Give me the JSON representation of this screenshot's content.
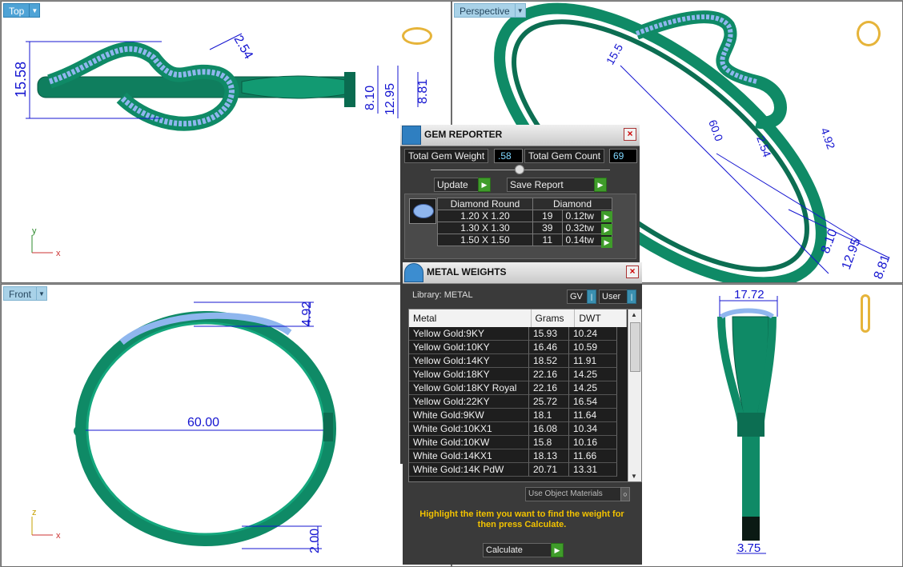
{
  "viewports": {
    "top": {
      "label": "Top",
      "axis_y": "y",
      "axis_x": "x",
      "dims": [
        "15.58",
        "2.54",
        "8.10",
        "12.95",
        "8.81"
      ]
    },
    "perspective": {
      "label": "Perspective",
      "dims": [
        "15.5",
        "60.0",
        "2.54",
        "4.92",
        "8.10",
        "12.95",
        "8.81"
      ]
    },
    "front": {
      "label": "Front",
      "axis_z": "z",
      "axis_x": "x",
      "dims": [
        "4.92",
        "60.00",
        "2.00"
      ]
    },
    "right": {
      "dims": [
        "17.72",
        "3.75"
      ]
    }
  },
  "gem_reporter": {
    "title": "GEM REPORTER",
    "total_weight_label": "Total Gem Weight",
    "total_weight_value": ".58",
    "total_count_label": "Total Gem Count",
    "total_count_value": "69",
    "update_label": "Update",
    "save_report_label": "Save Report",
    "columns": [
      "Diamond Round",
      "Diamond"
    ],
    "rows": [
      {
        "size": "1.20 X 1.20",
        "count": "19",
        "weight": "0.12tw"
      },
      {
        "size": "1.30 X 1.30",
        "count": "39",
        "weight": "0.32tw"
      },
      {
        "size": "1.50 X 1.50",
        "count": "11",
        "weight": "0.14tw"
      }
    ]
  },
  "metal_weights": {
    "title": "METAL WEIGHTS",
    "library": "Library: METAL",
    "gv_label": "GV",
    "user_label": "User",
    "columns": [
      "Metal",
      "Grams",
      "DWT"
    ],
    "rows": [
      {
        "metal": "Yellow Gold:9KY",
        "grams": "15.93",
        "dwt": "10.24"
      },
      {
        "metal": "Yellow Gold:10KY",
        "grams": "16.46",
        "dwt": "10.59"
      },
      {
        "metal": "Yellow Gold:14KY",
        "grams": "18.52",
        "dwt": "11.91"
      },
      {
        "metal": "Yellow Gold:18KY",
        "grams": "22.16",
        "dwt": "14.25"
      },
      {
        "metal": "Yellow Gold:18KY Royal",
        "grams": "22.16",
        "dwt": "14.25"
      },
      {
        "metal": "Yellow Gold:22KY",
        "grams": "25.72",
        "dwt": "16.54"
      },
      {
        "metal": "White Gold:9KW",
        "grams": "18.1",
        "dwt": "11.64"
      },
      {
        "metal": "White Gold:10KX1",
        "grams": "16.08",
        "dwt": "10.34"
      },
      {
        "metal": "White Gold:10KW",
        "grams": "15.8",
        "dwt": "10.16"
      },
      {
        "metal": "White Gold:14KX1",
        "grams": "18.13",
        "dwt": "11.66"
      },
      {
        "metal": "White Gold:14K PdW",
        "grams": "20.71",
        "dwt": "13.31"
      }
    ],
    "use_object_materials": "Use Object Materials",
    "hint": "Highlight the item you want to find the weight for then press Calculate.",
    "calculate_label": "Calculate"
  },
  "colors": {
    "metal": "#0f8a66",
    "gem": "#8fb6ee",
    "dimension": "#1414d0",
    "hint": "#f2c200"
  }
}
